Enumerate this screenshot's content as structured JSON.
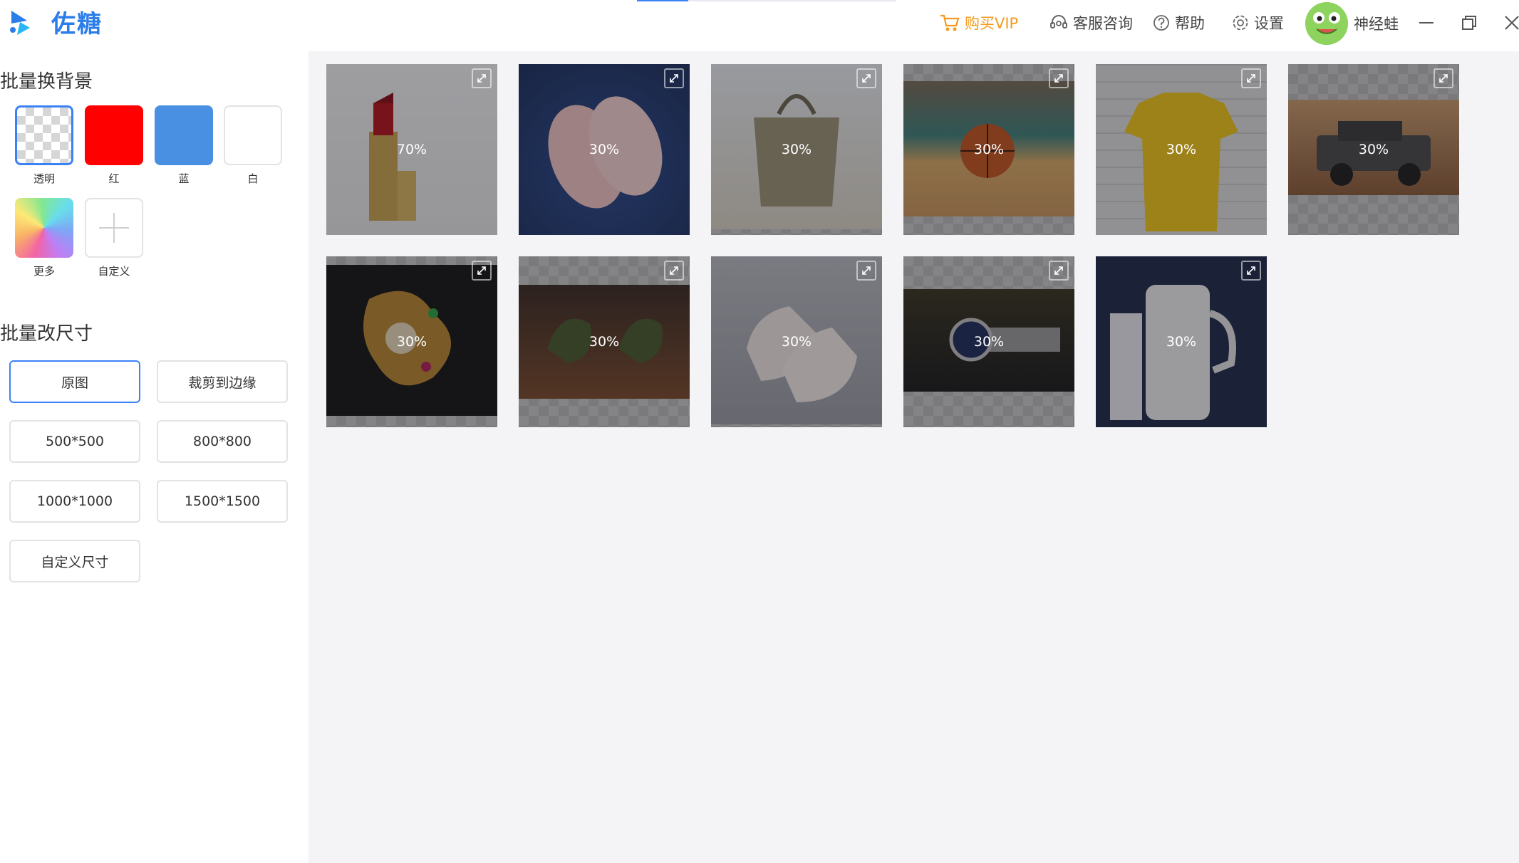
{
  "app": {
    "name": "佐糖"
  },
  "topbar": {
    "vip": "购买VIP",
    "consult": "客服咨询",
    "help": "帮助",
    "settings": "设置",
    "username": "神经蛙"
  },
  "sidebar": {
    "bg_title": "批量换背景",
    "swatches": [
      {
        "label": "透明",
        "color": "transparent"
      },
      {
        "label": "红",
        "color": "#ff0000"
      },
      {
        "label": "蓝",
        "color": "#4a90e2"
      },
      {
        "label": "白",
        "color": "#ffffff"
      },
      {
        "label": "更多",
        "color": "gradient"
      },
      {
        "label": "自定义",
        "color": "plus-icon"
      }
    ],
    "size_title": "批量改尺寸",
    "sizes": [
      "原图",
      "裁剪到边缘",
      "500*500",
      "800*800",
      "1000*1000",
      "1500*1500",
      "自定义尺寸"
    ],
    "active_size": "原图"
  },
  "images": [
    {
      "name": "lipstick",
      "progress": "70%"
    },
    {
      "name": "slippers",
      "progress": "30%"
    },
    {
      "name": "handbag",
      "progress": "30%"
    },
    {
      "name": "basketball",
      "progress": "30%"
    },
    {
      "name": "t-shirt",
      "progress": "30%"
    },
    {
      "name": "jeep",
      "progress": "30%"
    },
    {
      "name": "brooch",
      "progress": "30%"
    },
    {
      "name": "earbuds",
      "progress": "30%"
    },
    {
      "name": "sneakers",
      "progress": "30%"
    },
    {
      "name": "watch",
      "progress": "30%"
    },
    {
      "name": "thermos",
      "progress": "30%"
    }
  ],
  "colors": {
    "accent": "#3b82f6",
    "brand": "#2b7de9",
    "vip": "#f39a1e"
  }
}
